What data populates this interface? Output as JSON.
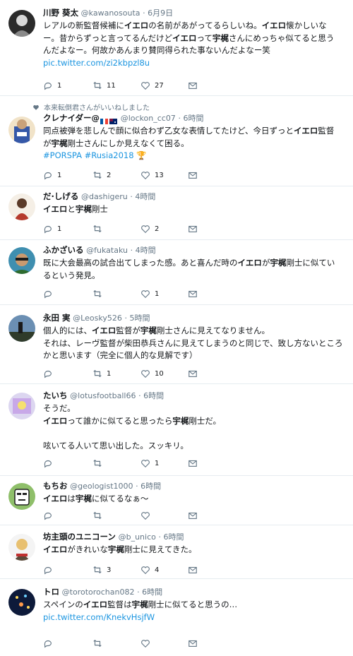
{
  "tweets": [
    {
      "name": "川野 葵太",
      "handle": "@kawanosouta",
      "time": "· 6月9日",
      "lines": [
        "レアルの新監督候補に<b>イエロ</b>の名前があがってるらしいね。<b>イエロ</b>懐かしいな",
        "ー。昔からずっと言ってるんだけど<b>イエロ</b>って<b>宇梶</b>さんにめっちゃ似てると思う",
        "んだよなー。何故かあんまり賛同得られた事ないんだよなー笑"
      ],
      "link": "pic.twitter.com/zi2kbpzl8u",
      "reply": "1",
      "retweet": "11",
      "like": "27"
    },
    {
      "retweeted_by": "本来転倒君さんがいいねしました",
      "name": "クレナイダー@",
      "handle": "@lockon_cc07",
      "time": "· 6時間",
      "lines": [
        "同点被弾を悲しんで顔に似合わず乙女な表情してたけど、今日ずっと<b>イエロ</b>監督",
        "が<b>宇梶</b>剛士さんにしか見えなくて困る。"
      ],
      "link": "#PORSPA #Rusia2018",
      "reply": "1",
      "retweet": "2",
      "like": "13"
    },
    {
      "name": "だ·しげる",
      "handle": "@dashigeru",
      "time": "· 4時間",
      "lines": [
        "<b>イエロ</b>と<b>宇梶</b>剛士"
      ],
      "link": "",
      "reply": "1",
      "retweet": "",
      "like": "2"
    },
    {
      "name": "ふかざいる",
      "handle": "@fukataku",
      "time": "· 4時間",
      "lines": [
        "既に大会最高の試合出てしまった感。あと喜んだ時の<b>イエロ</b>が<b>宇梶</b>剛士に似てい",
        "るという発見。"
      ],
      "link": "",
      "reply": "",
      "retweet": "",
      "like": "1"
    },
    {
      "name": "永田 実",
      "handle": "@Leosky526",
      "time": "· 5時間",
      "lines": [
        "個人的には、<b>イエロ</b>監督が<b>宇梶</b>剛士さんに見えてなりません。",
        "それは、レーヴ監督が柴田恭兵さんに見えてしまうのと同じで、致し方ないところ",
        "かと思います（完全に個人的な見解です）"
      ],
      "link": "",
      "reply": "",
      "retweet": "1",
      "like": "10"
    },
    {
      "name": "たいち",
      "handle": "@lotusfootball66",
      "time": "· 6時間",
      "lines": [
        "そうだ。",
        "<b>イエロ</b>って誰かに似てると思ったら<b>宇梶</b>剛士だ。",
        "",
        "呟いてる人いて思い出した。スッキリ。"
      ],
      "link": "",
      "reply": "",
      "retweet": "",
      "like": "1"
    },
    {
      "name": "もちお",
      "handle": "@geologist1000",
      "time": "· 6時間",
      "lines": [
        "<b>イエロ</b>は<b>宇梶</b>に似てるなぁ〜"
      ],
      "link": "",
      "reply": "",
      "retweet": "",
      "like": ""
    },
    {
      "name": "坊主頭のユニコーン",
      "handle": "@b_unico",
      "time": "· 6時間",
      "lines": [
        "<b>イエロ</b>がきれいな<b>宇梶</b>剛士に見えてきた。"
      ],
      "link": "",
      "reply": "",
      "retweet": "3",
      "like": "4"
    },
    {
      "name": "トロ",
      "handle": "@torotorochan082",
      "time": "· 6時間",
      "lines": [
        "スペインの<b>イエロ</b>監督は<b>宇梶</b>剛士に似てると思うの…"
      ],
      "link": "pic.twitter.com/KnekvHsjfW",
      "reply": "",
      "retweet": "",
      "like": ""
    }
  ],
  "colors": {
    "link": "#1b95e0",
    "muted": "#657786",
    "text": "#14171a",
    "divider": "#e6ecf0"
  }
}
